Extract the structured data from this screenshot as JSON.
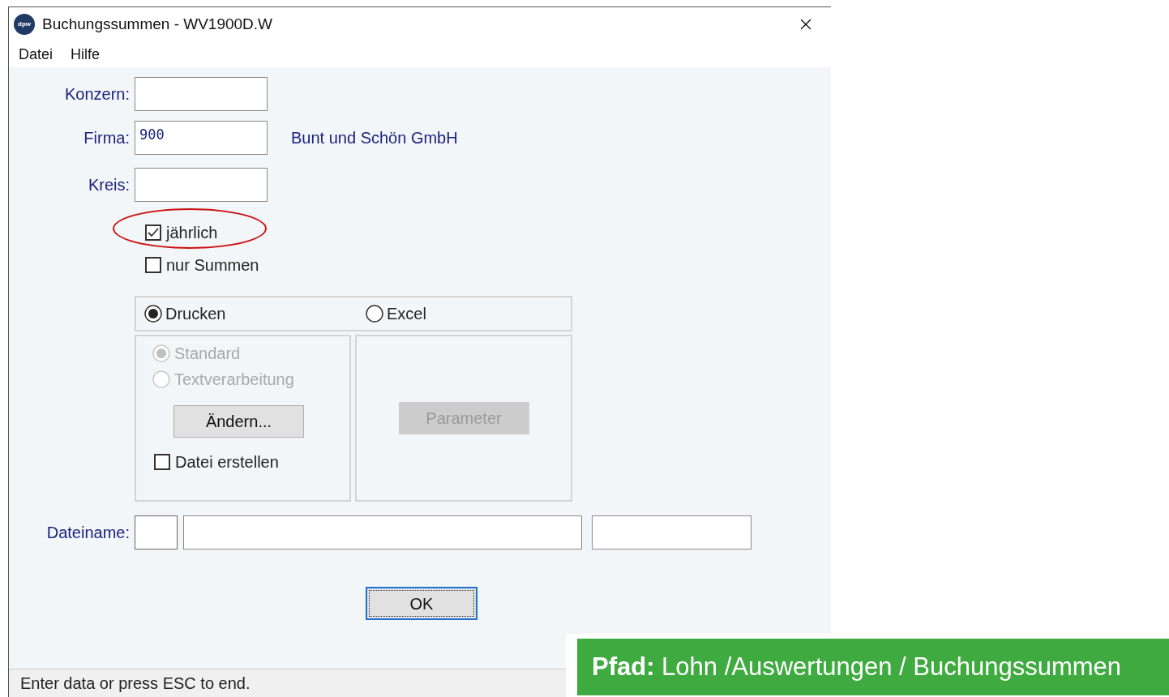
{
  "window": {
    "title": "Buchungssummen - WV1900D.W",
    "icon_label": "dpw"
  },
  "menu": [
    {
      "label": "Datei"
    },
    {
      "label": "Hilfe"
    }
  ],
  "fields": [
    {
      "label": "Konzern:"
    },
    {
      "label": "Firma:",
      "value": "900",
      "note": "Bunt und Schön GmbH"
    },
    {
      "label": "Kreis:"
    }
  ],
  "checkboxes": [
    {
      "label": "jährlich",
      "checked": true,
      "highlighted": true
    },
    {
      "label": "nur Summen",
      "checked": false,
      "highlighted": false
    }
  ],
  "output": {
    "options": [
      {
        "label": "Drucken",
        "selected": true
      },
      {
        "label": "Excel",
        "selected": false
      }
    ],
    "print_formats": [
      {
        "label": "Standard",
        "selected": true,
        "disabled": true
      },
      {
        "label": "Textverarbeitung",
        "selected": false,
        "disabled": true
      }
    ],
    "change_button": {
      "label": "Ändern...",
      "disabled": false
    },
    "create_file": {
      "label": "Datei erstellen",
      "checked": false
    },
    "parameter_button": {
      "label": "Parameter",
      "disabled": true
    }
  },
  "filename": {
    "label": "Dateiname:"
  },
  "ok_button": {
    "label": "OK"
  },
  "status_bar": "Enter data or press ESC to end.",
  "path_banner": {
    "text": "**Pfad:** Lohn /Auswertungen / Buchungssummen"
  }
}
